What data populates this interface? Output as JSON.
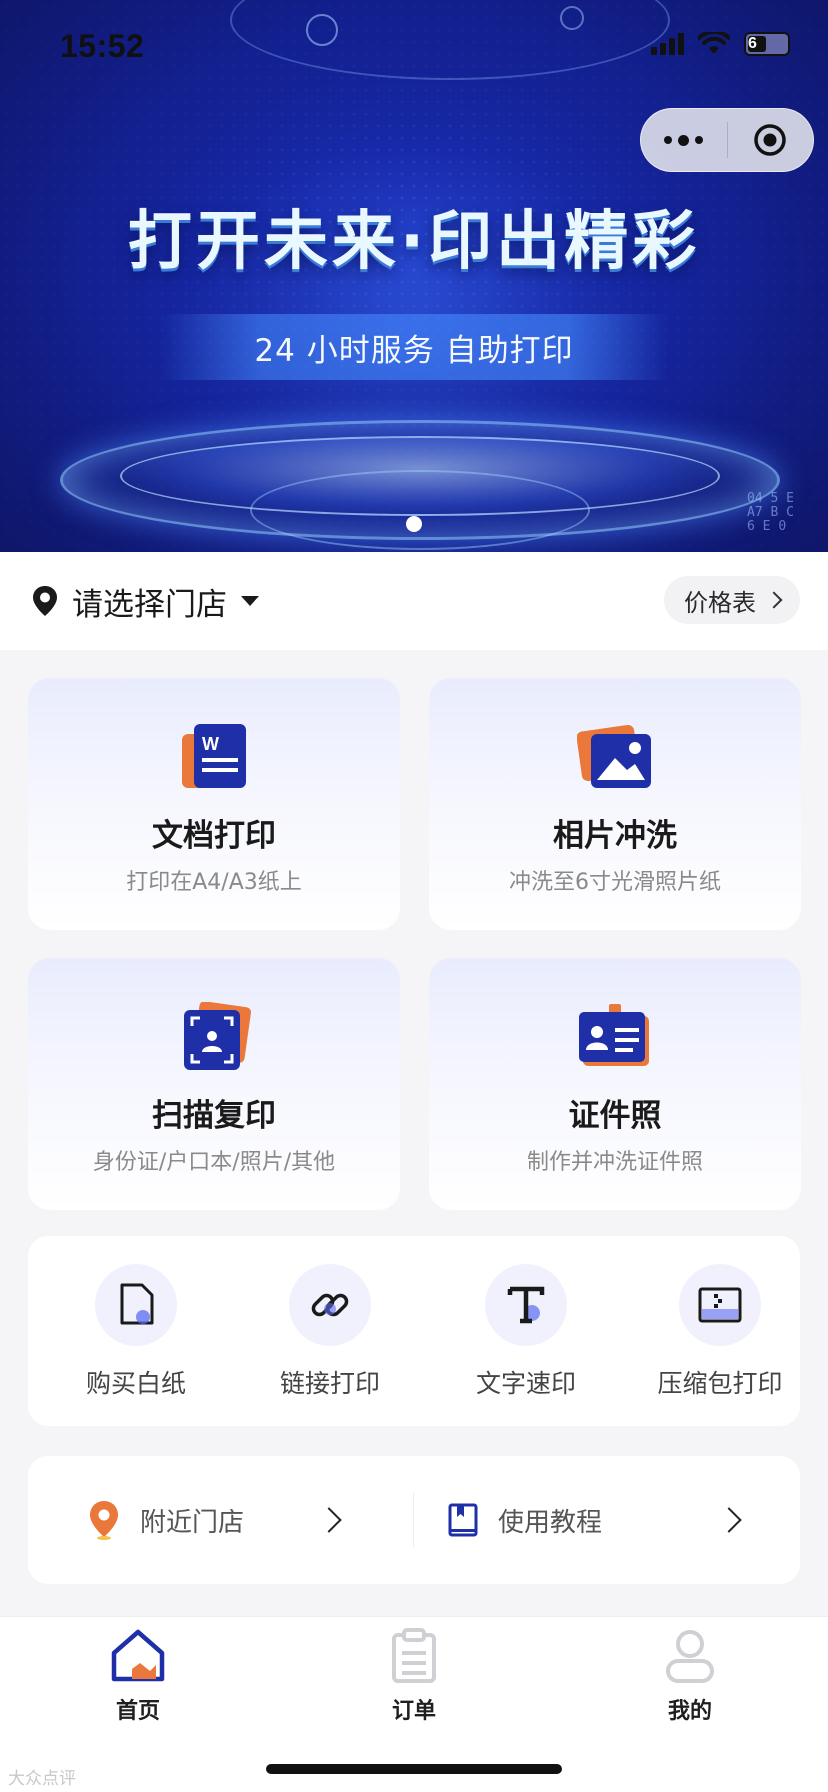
{
  "status_bar": {
    "time": "15:52",
    "battery": "6"
  },
  "banner": {
    "headline": "打开未来·印出精彩",
    "subtitle": "24 小时服务 自助打印",
    "hex_lines": [
      "04  5 E",
      "A7  B  C",
      "6   E 0"
    ]
  },
  "store": {
    "label": "请选择门店",
    "price_label": "价格表"
  },
  "services": [
    {
      "title": "文档打印",
      "desc": "打印在A4/A3纸上"
    },
    {
      "title": "相片冲洗",
      "desc": "冲洗至6寸光滑照片纸"
    },
    {
      "title": "扫描复印",
      "desc": "身份证/户口本/照片/其他"
    },
    {
      "title": "证件照",
      "desc": "制作并冲洗证件照"
    }
  ],
  "tools": [
    {
      "label": "购买白纸",
      "icon": "paper-icon"
    },
    {
      "label": "链接打印",
      "icon": "link-icon"
    },
    {
      "label": "文字速印",
      "icon": "text-icon"
    },
    {
      "label": "压缩包打印",
      "icon": "zip-icon"
    }
  ],
  "links": [
    {
      "label": "附近门店",
      "icon": "location-pin-icon"
    },
    {
      "label": "使用教程",
      "icon": "book-icon"
    }
  ],
  "tabs": [
    {
      "label": "首页",
      "icon": "home-icon",
      "active": true
    },
    {
      "label": "订单",
      "icon": "clipboard-icon",
      "active": false
    },
    {
      "label": "我的",
      "icon": "user-icon",
      "active": false
    }
  ],
  "colors": {
    "accent": "#1f2fa8",
    "orange": "#e9783a",
    "tab_active": "#1a1a1a",
    "tab_inactive": "#1a1a1a"
  },
  "watermark": "大众点评"
}
